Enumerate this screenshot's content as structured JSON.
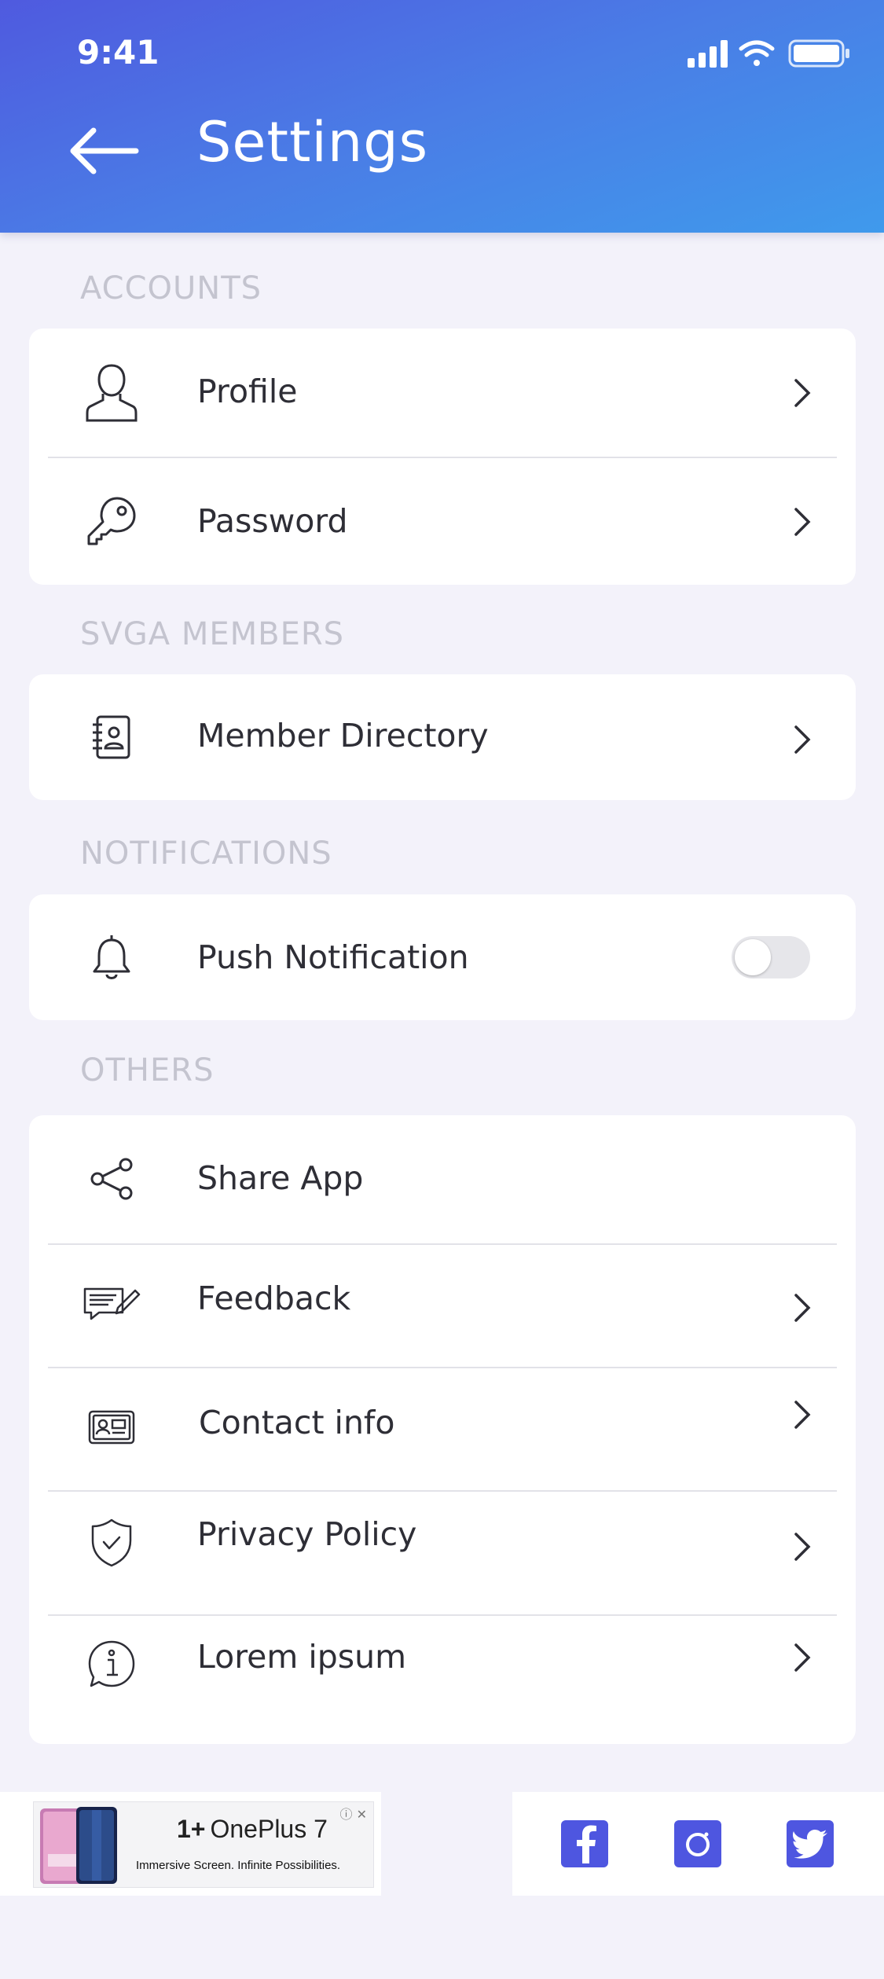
{
  "status_bar": {
    "time": "9:41"
  },
  "header": {
    "title": "Settings"
  },
  "sections": {
    "accounts": {
      "label": "ACCOUNTS",
      "items": [
        {
          "label": "Profile",
          "icon": "user-icon"
        },
        {
          "label": "Password",
          "icon": "key-icon"
        }
      ]
    },
    "members": {
      "label": "SVGA MEMBERS",
      "items": [
        {
          "label": "Member Directory",
          "icon": "address-book-icon"
        }
      ]
    },
    "notifications": {
      "label": "NOTIFICATIONS",
      "items": [
        {
          "label": "Push Notification",
          "icon": "bell-icon",
          "toggle_on": false
        }
      ]
    },
    "others": {
      "label": "OTHERS",
      "items": [
        {
          "label": "Share App",
          "icon": "share-icon"
        },
        {
          "label": "Feedback",
          "icon": "feedback-icon"
        },
        {
          "label": "Contact info",
          "icon": "contact-card-icon"
        },
        {
          "label": "Privacy Policy",
          "icon": "shield-check-icon"
        },
        {
          "label": "Lorem ipsum",
          "icon": "info-icon"
        }
      ]
    }
  },
  "ad": {
    "brand": "OnePlus 7",
    "brand_mark": "1+",
    "tagline": "Immersive Screen. Infinite Possibilities.",
    "close": "ⓘ ✕"
  },
  "social": {
    "accent": "#4e56e0",
    "icons": [
      "facebook-icon",
      "instagram-icon",
      "twitter-icon"
    ]
  },
  "colors": {
    "header_start": "#4f5adf",
    "header_end": "#3f9aec",
    "background": "#f3f2fa"
  }
}
